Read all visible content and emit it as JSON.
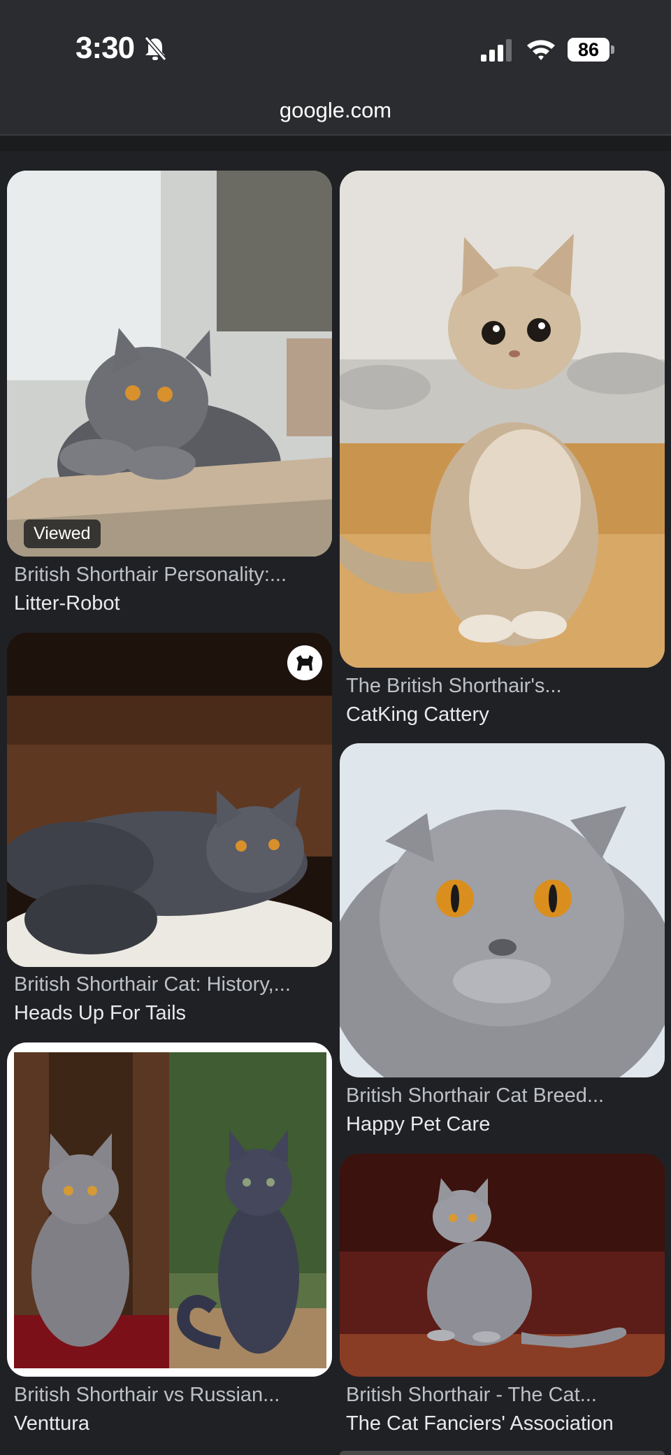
{
  "status_bar": {
    "time": "3:30",
    "battery": "86",
    "icons": [
      "bell-slash-icon",
      "cellular-signal-icon",
      "wifi-icon",
      "battery-icon"
    ]
  },
  "browser": {
    "url": "google.com"
  },
  "results": [
    {
      "title": "British Shorthair Personality:...",
      "source": "Litter-Robot",
      "badge": "Viewed"
    },
    {
      "title": "The British Shorthair's...",
      "source": "CatKing Cattery"
    },
    {
      "title": "British Shorthair Cat: History,...",
      "source": "Heads Up For Tails",
      "icon": "dog-icon"
    },
    {
      "title": "British Shorthair Cat Breed...",
      "source": "Happy Pet Care"
    },
    {
      "title": "British Shorthair vs Russian...",
      "source": "Venttura"
    },
    {
      "title": "British Shorthair - The Cat...",
      "source": "The Cat Fanciers' Association"
    }
  ]
}
